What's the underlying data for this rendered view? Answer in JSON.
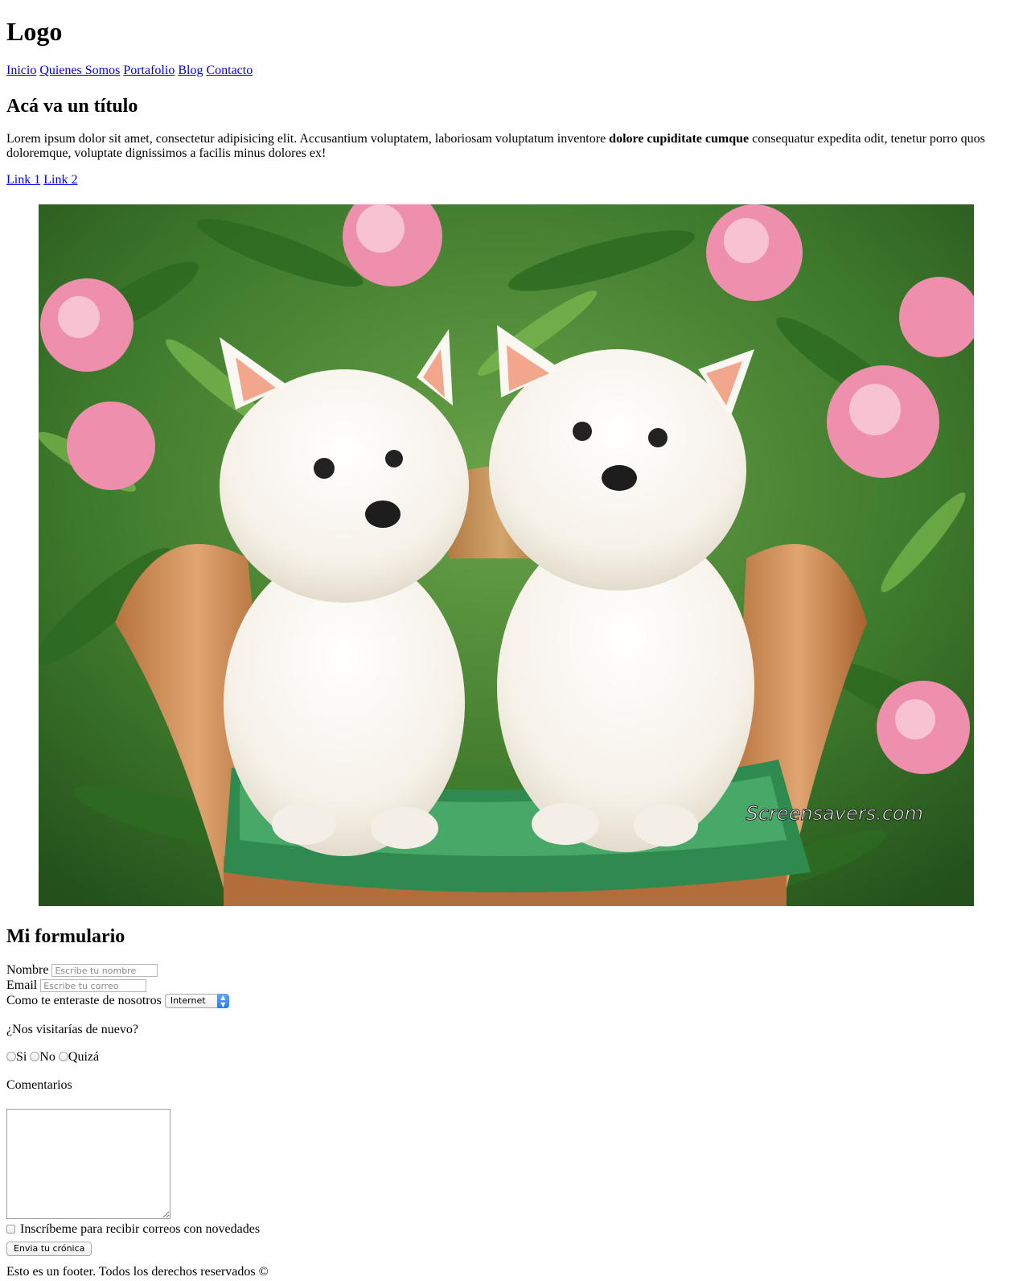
{
  "header": {
    "logo": "Logo"
  },
  "nav": {
    "items": [
      {
        "label": "Inicio"
      },
      {
        "label": "Quienes Somos"
      },
      {
        "label": "Portafolio"
      },
      {
        "label": "Blog"
      },
      {
        "label": "Contacto"
      }
    ]
  },
  "article": {
    "title": "Acá va un título",
    "text_before": "Lorem ipsum dolor sit amet, consectetur adipisicing elit. Accusantium voluptatem, laboriosam voluptatum inventore ",
    "text_bold": "dolore cupiditate cumque",
    "text_after": " consequatur expedita odit, tenetur porro quos doloremque, voluptate dignissimos a facilis minus dolores ex!",
    "links": [
      {
        "label": "Link 1"
      },
      {
        "label": "Link 2"
      }
    ],
    "image_watermark": "Screensavers.com"
  },
  "form": {
    "title": "Mi formulario",
    "name_label": "Nombre",
    "name_placeholder": "Escribe tu nombre",
    "email_label": "Email",
    "email_placeholder": "Escribe tu correo",
    "source_label": "Como te enteraste de nosotros",
    "source_selected": "Internet",
    "visit_question": "¿Nos visitarías de nuevo?",
    "visit_options": [
      {
        "label": "Si"
      },
      {
        "label": "No"
      },
      {
        "label": "Quizá"
      }
    ],
    "comments_label": "Comentarios",
    "newsletter_label": "Inscríbeme para recibir correos con novedades",
    "submit_label": "Envia tu crónica"
  },
  "footer": {
    "text": "Esto es un footer. Todos los derechos reservados ©"
  },
  "colors": {
    "link": "#0000ee",
    "select_accent": "#2c7be5"
  }
}
